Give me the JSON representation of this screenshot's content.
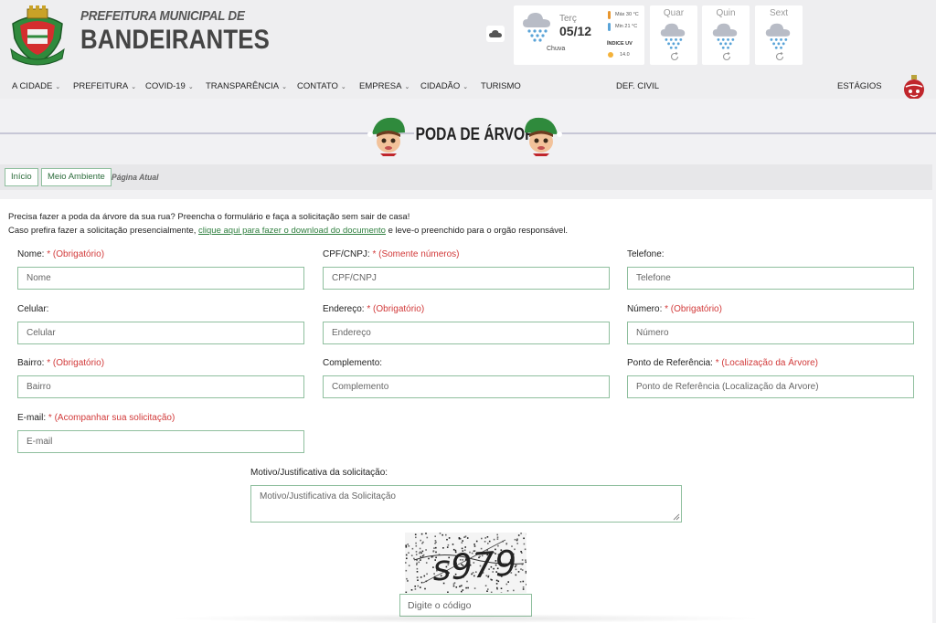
{
  "header": {
    "brand_small": "PREFEITURA MUNICIPAL DE",
    "brand_big": "BANDEIRANTES",
    "weather_icon": "cloud-icon"
  },
  "weather": {
    "today": {
      "day": "Terç",
      "date": "05/12",
      "condition": "Chuva",
      "max": "Máx 30 °C",
      "min": "Min 21 °C",
      "uv_label": "ÍNDICE UV",
      "uv": "14.0"
    },
    "forecast": [
      {
        "day": "Quar"
      },
      {
        "day": "Quin"
      },
      {
        "day": "Sext"
      }
    ]
  },
  "nav": {
    "items": [
      {
        "label": "A CIDADE",
        "dropdown": true
      },
      {
        "label": "PREFEITURA",
        "dropdown": true
      },
      {
        "label": "COVID-19",
        "dropdown": true
      },
      {
        "label": "TRANSPARÊNCIA",
        "dropdown": true
      },
      {
        "label": "CONTATO",
        "dropdown": true
      },
      {
        "label": "EMPRESA",
        "dropdown": true
      },
      {
        "label": "CIDADÃO",
        "dropdown": true
      },
      {
        "label": "TURISMO",
        "dropdown": false
      },
      {
        "label": "DEF. CIVIL",
        "dropdown": false
      },
      {
        "label": "ESTÁGIOS",
        "dropdown": false
      }
    ]
  },
  "page": {
    "title": "PODA DE ÁRVORE"
  },
  "breadcrumb": {
    "home": "Início",
    "section": "Meio Ambiente",
    "current": "Página Atual"
  },
  "intro": {
    "line1": "Precisa fazer a poda da árvore da sua rua? Preencha o formulário e faça a solicitação sem sair de casa!",
    "line2_prefix": "Caso prefira fazer a solicitação presencialmente, ",
    "line2_link": "clique aqui para fazer o download do documento",
    "line2_suffix": " e leve-o preenchido para o orgão responsável."
  },
  "form": {
    "nome": {
      "label": "Nome:",
      "req": "* (Obrigatório)",
      "placeholder": "Nome"
    },
    "cpf": {
      "label": "CPF/CNPJ:",
      "req": "* (Somente números)",
      "placeholder": "CPF/CNPJ"
    },
    "telefone": {
      "label": "Telefone:",
      "placeholder": "Telefone"
    },
    "celular": {
      "label": "Celular:",
      "placeholder": "Celular"
    },
    "endereco": {
      "label": "Endereço:",
      "req": "* (Obrigatório)",
      "placeholder": "Endereço"
    },
    "numero": {
      "label": "Número:",
      "req": "* (Obrigatório)",
      "placeholder": "Número"
    },
    "bairro": {
      "label": "Bairro:",
      "req": "* (Obrigatório)",
      "placeholder": "Bairro"
    },
    "complemento": {
      "label": "Complemento:",
      "placeholder": "Complemento"
    },
    "referencia": {
      "label": "Ponto de Referência:",
      "req": "* (Localização da Árvore)",
      "placeholder": "Ponto de Referência (Localização da Árvore)"
    },
    "email": {
      "label": "E-mail:",
      "req": "* (Acompanhar sua solicitação)",
      "placeholder": "E-mail"
    },
    "motivo": {
      "label": "Motivo/Justificativa da solicitação:",
      "placeholder": "Motivo/Justificativa da Solicitação"
    },
    "captcha_text": "s979",
    "code": {
      "placeholder": "Digite o código"
    }
  },
  "colors": {
    "accent_green": "#2f7f3f",
    "field_border": "#8fbf9e",
    "required_red": "#d23a3a"
  }
}
